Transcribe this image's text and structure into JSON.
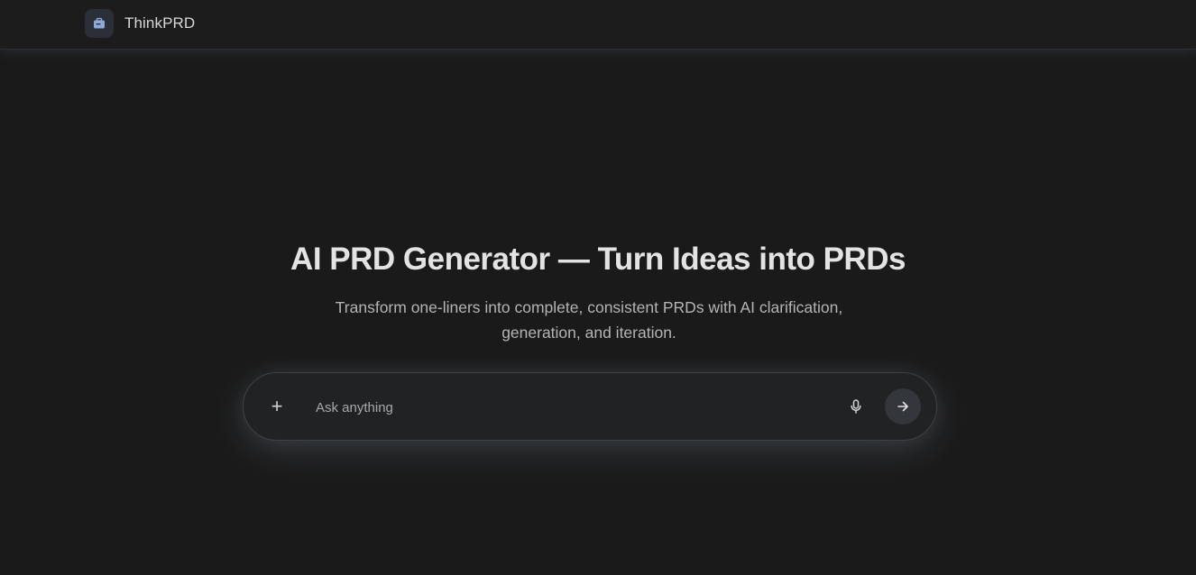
{
  "header": {
    "brand": "ThinkPRD",
    "logo_icon": "briefcase-icon"
  },
  "hero": {
    "title": "AI PRD Generator — Turn Ideas into PRDs",
    "subtitle": "Transform one-liners into complete, consistent PRDs with AI clarification, generation, and iteration."
  },
  "composer": {
    "placeholder": "Ask anything",
    "value": "",
    "plus_label": "+",
    "mic_icon": "microphone-icon",
    "send_icon": "arrow-right-icon"
  },
  "colors": {
    "background": "#1a1a1a",
    "logo_accent": "#8fa8d8"
  }
}
